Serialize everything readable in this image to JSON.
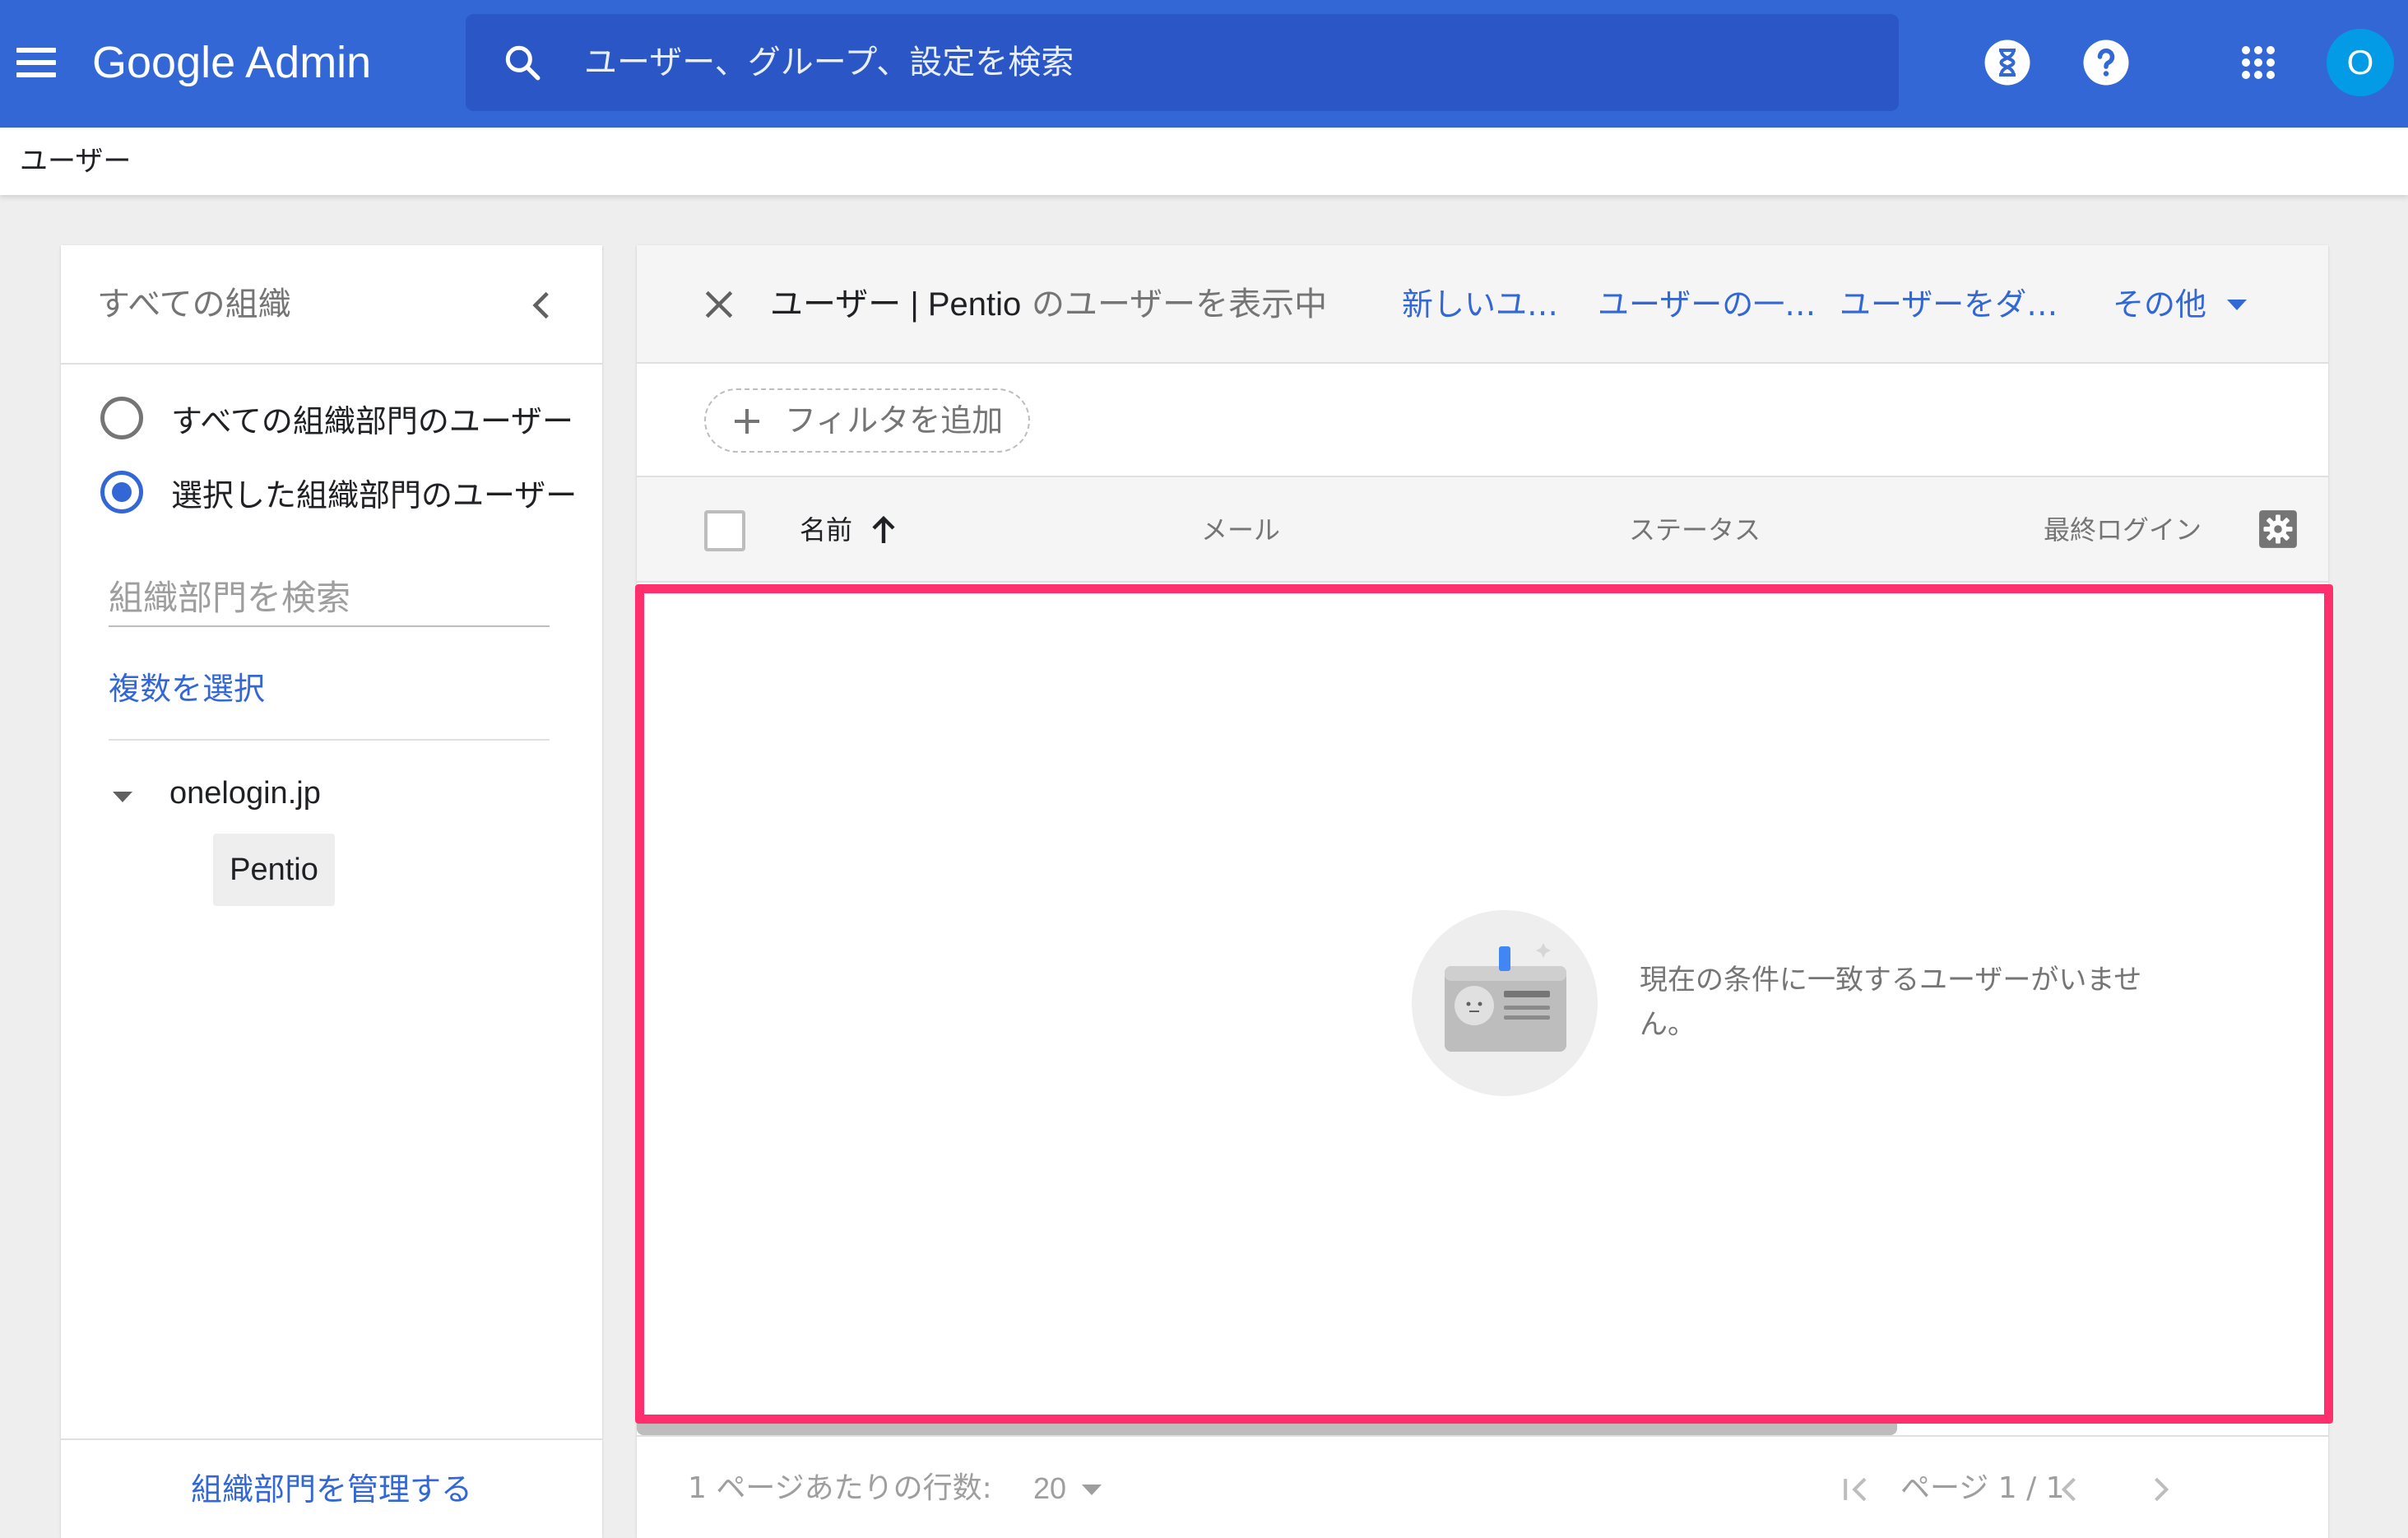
{
  "app": {
    "brand": "Google Admin",
    "search_placeholder": "ユーザー、グループ、設定を検索",
    "avatar_letter": "O"
  },
  "page": {
    "title": "ユーザー"
  },
  "sidebar": {
    "header": "すべての組織",
    "radio_options": [
      {
        "label": "すべての組織部門のユーザー",
        "checked": false
      },
      {
        "label": "選択した組織部門のユーザー",
        "checked": true
      }
    ],
    "org_search_placeholder": "組織部門を検索",
    "multi_select": "複数を選択",
    "tree": {
      "root": "onelogin.jp",
      "child": "Pentio"
    },
    "manage_link": "組織部門を管理する"
  },
  "main": {
    "toolbar": {
      "title_prefix": "ユーザー | Pentio",
      "title_suffix": " のユーザーを表示中",
      "actions": [
        "新しいユ…",
        "ユーザーの一…",
        "ユーザーをダ…",
        "その他"
      ]
    },
    "filter": {
      "add_label": "フィルタを追加"
    },
    "columns": [
      "名前",
      "メール",
      "ステータス",
      "最終ログイン"
    ],
    "empty_message": "現在の条件に一致するユーザーがいません。",
    "footer": {
      "rows_label": "1 ページあたりの行数:",
      "rows_value": "20",
      "page_label": "ページ 1 / 1"
    }
  },
  "colors": {
    "appbar": "#3367d6",
    "search": "#2a56c6",
    "link": "#3367d6",
    "avatar": "#039be5",
    "highlight": "#ff2e6c"
  }
}
